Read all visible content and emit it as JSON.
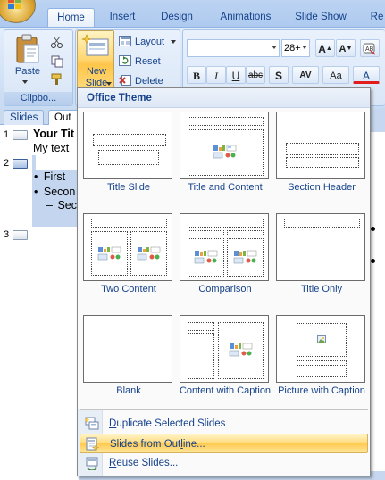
{
  "ribbon": {
    "tabs": [
      "Home",
      "Insert",
      "Design",
      "Animations",
      "Slide Show",
      "Re"
    ],
    "active_tab": "Home",
    "clipboard": {
      "paste_label": "Paste",
      "group_label": "Clipbo..."
    },
    "slides": {
      "new_slide_line1": "New",
      "new_slide_line2": "Slide",
      "layout_label": "Layout",
      "reset_label": "Reset",
      "delete_label": "Delete"
    },
    "font": {
      "font_name": "",
      "font_size": "28+"
    },
    "format_buttons": [
      "B",
      "I",
      "U",
      "abc",
      "S",
      "AV",
      "Aa",
      "A"
    ]
  },
  "left_pane": {
    "tabs": [
      "Slides",
      "Out"
    ],
    "active_tab": "Out",
    "outline": {
      "slide1_num": "1",
      "slide1_title": "Your Tit",
      "slide1_text": "My text",
      "slide2_num": "2",
      "bullet1": "First",
      "bullet2": "Secon",
      "bullet3": "Seco",
      "slide3_num": "3"
    }
  },
  "menu": {
    "header": "Office Theme",
    "layouts": [
      {
        "label": "Title Slide"
      },
      {
        "label": "Title and Content"
      },
      {
        "label": "Section Header"
      },
      {
        "label": "Two Content"
      },
      {
        "label": "Comparison"
      },
      {
        "label": "Title Only"
      },
      {
        "label": "Blank"
      },
      {
        "label": "Content with Caption"
      },
      {
        "label": "Picture with Caption"
      }
    ],
    "commands": [
      {
        "pre": "",
        "key": "D",
        "post": "uplicate Selected Slides"
      },
      {
        "pre": "Slides from Out",
        "key": "l",
        "post": "ine..."
      },
      {
        "pre": "",
        "key": "R",
        "post": "euse Slides..."
      }
    ]
  },
  "colors": {
    "accent": "#15428b",
    "highlight": "#ffd978",
    "ribbon": "#dbe7f7"
  }
}
